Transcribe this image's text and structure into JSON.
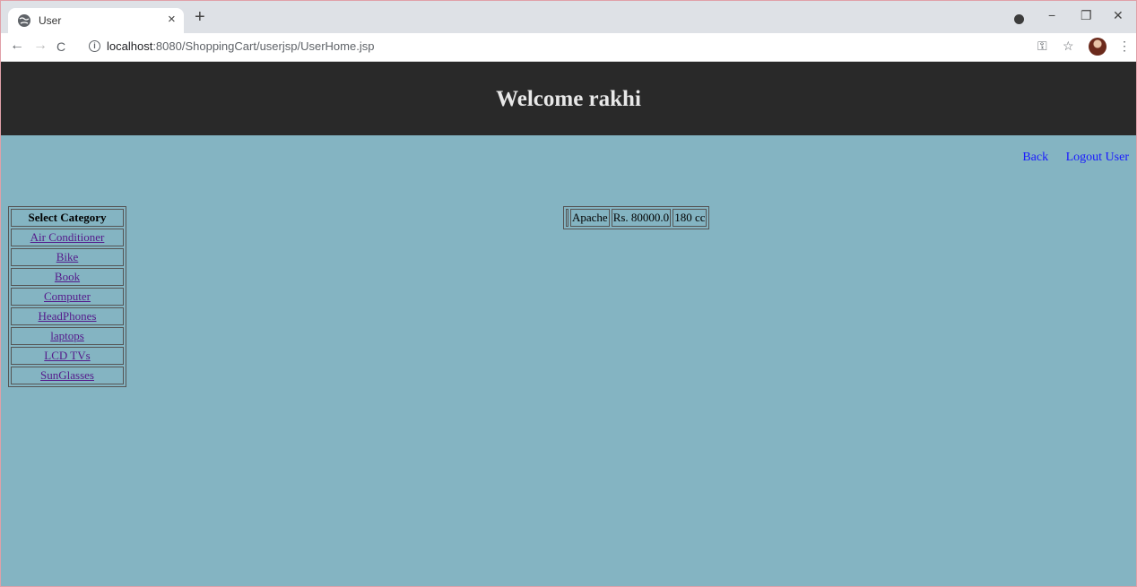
{
  "browser": {
    "tab_title": "User",
    "tab_close": "×",
    "new_tab": "+",
    "url_host": "localhost",
    "url_path": ":8080/ShoppingCart/userjsp/UserHome.jsp",
    "window_controls": {
      "minimize": "−",
      "restore": "❐",
      "close": "✕"
    },
    "nav": {
      "back": "←",
      "forward": "→",
      "reload": "C"
    },
    "toolbar_icons": {
      "key": "⚿",
      "star": "☆",
      "menu": "⋮"
    }
  },
  "header": {
    "title": "Welcome rakhi",
    "background": "#292929"
  },
  "links": {
    "back": "Back",
    "logout": "Logout User"
  },
  "categories": {
    "heading": "Select Category",
    "items": [
      "Air Conditioner",
      "Bike",
      "Book",
      "Computer",
      "HeadPhones",
      "laptops",
      "LCD TVs",
      "SunGlasses"
    ]
  },
  "product": {
    "name": "Apache",
    "price": "Rs. 80000.0",
    "spec": "180 cc"
  },
  "colors": {
    "page_background": "#84b4c2",
    "link": "#1a1aff",
    "visited_link": "#551a8b"
  }
}
